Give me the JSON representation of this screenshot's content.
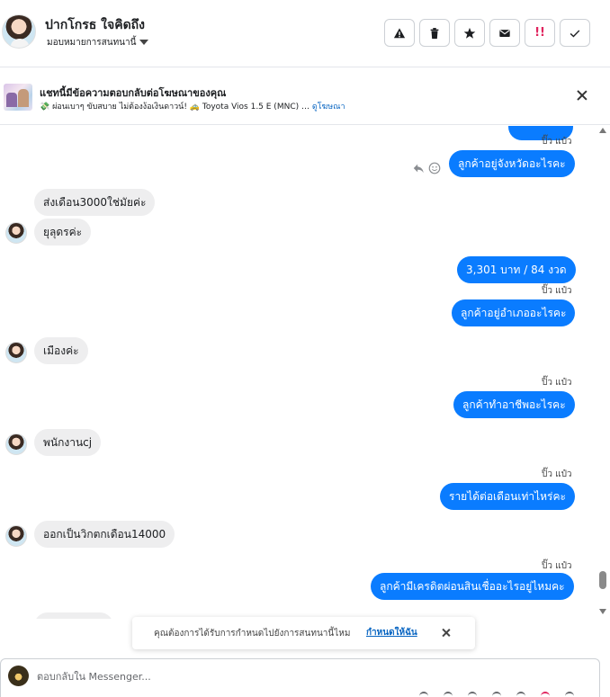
{
  "header": {
    "contact_name": "ปากโกรธ ใจคิดถึง",
    "assign_label": "มอบหมายการสนทนานี้"
  },
  "ad_banner": {
    "title": "แชทนี้มีข้อความตอบกลับต่อโฆษณาของคุณ",
    "subtitle": "💸 ผ่อนเบาๆ ขับสบาย ไม่ต้องง้อเงินดาวน์! 🚕 Toyota Vios 1.5 E (MNC) …",
    "link_label": "ดูโฆษณา"
  },
  "messages": {
    "seen_label": "ปิ๊ว แป๋ว",
    "out_1": "ลูกค้าอยู่จังหวัดอะไรคะ",
    "in_1": "ส่งเดือน3000ใช่มัยค่ะ",
    "in_2": "ยุลุดรค่ะ",
    "out_2": "3,301 บาท  / 84 งวด",
    "out_3": "ลูกค้าอยู่อำเภออะไรคะ",
    "in_3": "เมืองค่ะ",
    "out_4": "ลูกค้าทำอาชีพอะไรคะ",
    "in_4": "พนักงานcj",
    "out_5": "รายได้ต่อเดือนเท่าไหร่คะ",
    "in_5": "ออกเป็นวิกตกเดือน14000",
    "out_6": "ลูกค้ามีเครดิตผ่อนสินเชื่ออะไรอยู่ไหมคะ"
  },
  "toast": {
    "text": "คุณต้องการได้รับการกำหนดไปยังการสนทนานี้ไหม",
    "link_label": "กำหนดให้ฉัน"
  },
  "composer": {
    "placeholder": "ตอบกลับใน Messenger..."
  },
  "colors": {
    "outgoing_bubble": "#0a7cff",
    "incoming_bubble": "#eeeeef",
    "link": "#0a66c2",
    "spam_icon": "#e0245e"
  },
  "icons": {
    "header_actions": [
      "warning-icon",
      "trash-icon",
      "star-icon",
      "mail-icon",
      "spam-icon",
      "check-icon"
    ]
  }
}
